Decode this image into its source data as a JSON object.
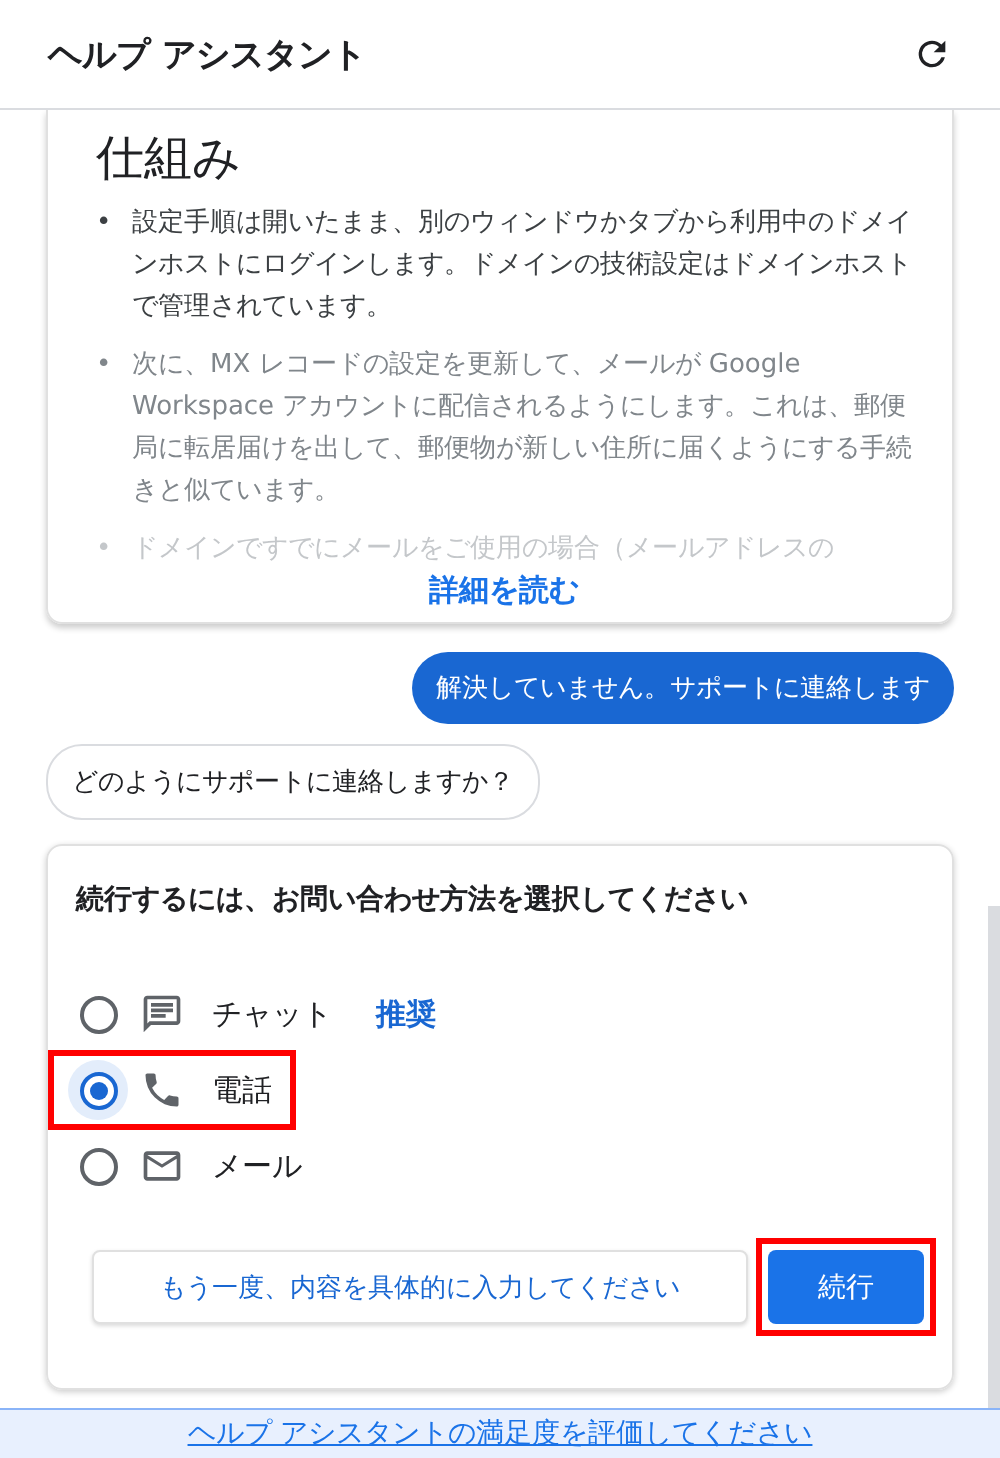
{
  "header": {
    "title": "ヘルプ アシスタント"
  },
  "article": {
    "heading": "仕組み",
    "bullets": [
      {
        "marker": "•",
        "text": "設定手順は開いたまま、別のウィンドウかタブから利用中のドメインホストにログインします。ドメインの技術設定はドメインホストで管理されています。"
      },
      {
        "marker": "•",
        "text": "次に、MX レコードの設定を更新して、メールが Google Workspace アカウントに配信されるようにします。これは、郵便局に転居届けを出して、郵便物が新しい住所に届くようにする手続きと似ています。"
      },
      {
        "marker": "•",
        "text": "ドメインですでにメールをご使用の場合（メールアドレスの"
      }
    ],
    "read_more": "詳細を読む"
  },
  "messages": [
    {
      "kind": "user",
      "text": "解決していません。サポートに連絡します"
    },
    {
      "kind": "assistant",
      "text": "どのようにサポートに連絡しますか？"
    }
  ],
  "contact_card": {
    "prompt": "続行するには、お問い合わせ方法を選択してください",
    "options": [
      {
        "kind": "chat",
        "label": "チャット",
        "badge": "推奨",
        "selected": false,
        "highlighted": false
      },
      {
        "kind": "phone",
        "label": "電話",
        "selected": true,
        "highlighted": true
      },
      {
        "kind": "mail",
        "label": "メール",
        "selected": false,
        "highlighted": false
      }
    ],
    "buttons": [
      {
        "kind": "secondary",
        "label": "もう一度、内容を具体的に入力してください",
        "highlighted": false
      },
      {
        "kind": "primary",
        "label": "続行",
        "highlighted": true
      }
    ]
  },
  "footer": {
    "link": "ヘルプ アシスタントの満足度を評価してください"
  }
}
